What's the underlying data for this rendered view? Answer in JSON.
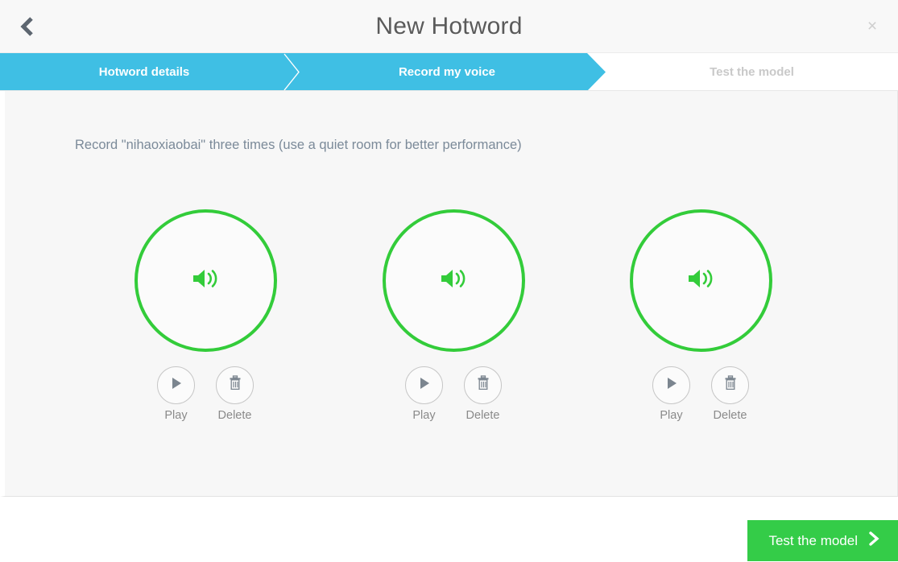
{
  "header": {
    "title": "New Hotword",
    "back_icon": "chevron-left-icon",
    "close_label": "×"
  },
  "steps": [
    {
      "label": "Hotword details",
      "state": "complete"
    },
    {
      "label": "Record my voice",
      "state": "active"
    },
    {
      "label": "Test the model",
      "state": "upcoming"
    }
  ],
  "content": {
    "instruction": "Record \"nihaoxiaobai\" three times (use a quiet room for better performance)",
    "hotword": "nihaoxiaobai",
    "recordings": [
      {
        "index": 1,
        "icon": "speaker-icon",
        "play_label": "Play",
        "delete_label": "Delete"
      },
      {
        "index": 2,
        "icon": "speaker-icon",
        "play_label": "Play",
        "delete_label": "Delete"
      },
      {
        "index": 3,
        "icon": "speaker-icon",
        "play_label": "Play",
        "delete_label": "Delete"
      }
    ]
  },
  "footer": {
    "primary_label": "Test the model"
  },
  "colors": {
    "step_active": "#3fbfe4",
    "step_upcoming_text": "#c9c9c9",
    "record_green": "#33cc3a",
    "button_green": "#34cc48",
    "content_bg": "#f7f7f7",
    "titlebar_bg": "#f8f8f8",
    "instruction_text": "#7b8a99",
    "title_text": "#5a5a5a"
  }
}
